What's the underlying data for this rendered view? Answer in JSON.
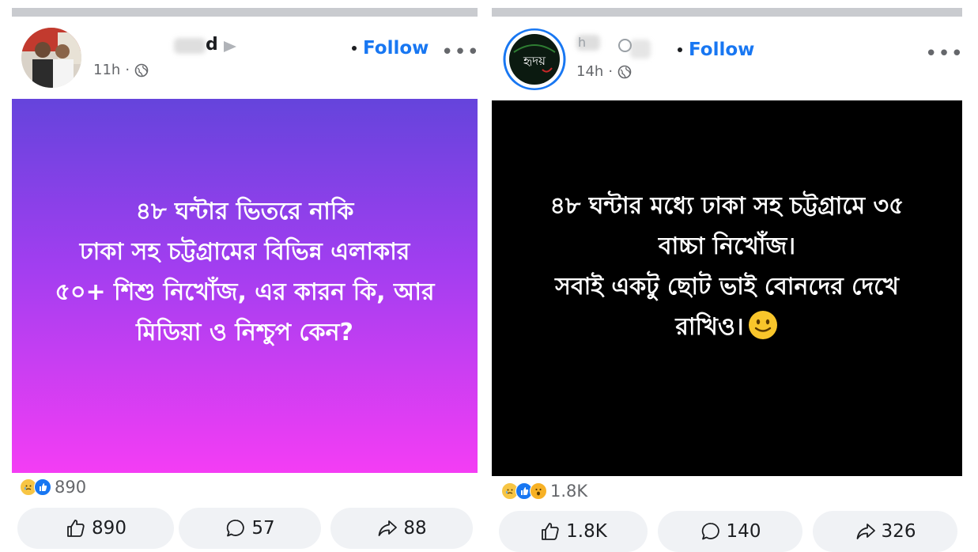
{
  "posts": [
    {
      "author_fragment": "d",
      "time": "11h",
      "follow_label": "Follow",
      "more_label": "•••",
      "text": "৪৮ ঘন্টার ভিতরে নাকি\nঢাকা সহ চট্টগ্রামের বিভিন্ন এলাকার\n৫০+ শিশু নিখোঁজ, এর কারন কি, আর\nমিডিয়া ও নিশ্চুপ কেন?",
      "reaction_count": "890",
      "like_count": "890",
      "comment_count": "57",
      "share_count": "88"
    },
    {
      "author_fragment": "h",
      "time": "14h",
      "follow_label": "Follow",
      "more_label": "•••",
      "text": "৪৮ ঘন্টার মধ্যে  ঢাকা সহ চট্টগ্রামে ৩৫\nবাচ্চা নিখোঁজ।\nসবাই একটু ছোট ভাই বোনদের দেখে\nরাখিও।",
      "reaction_count": "1.8K",
      "like_count": "1.8K",
      "comment_count": "140",
      "share_count": "326",
      "avatar_text": "হৃদয়"
    }
  ],
  "colors": {
    "follow": "#1877f2",
    "button_bg": "#f0f2f5",
    "gradient_top": "#6544dc",
    "gradient_bottom": "#f43df4"
  },
  "icons": [
    "globe-icon",
    "like-icon",
    "comment-icon",
    "share-icon",
    "sad-reaction-icon",
    "like-reaction-icon",
    "wow-reaction-icon",
    "smile-emoji-icon"
  ]
}
